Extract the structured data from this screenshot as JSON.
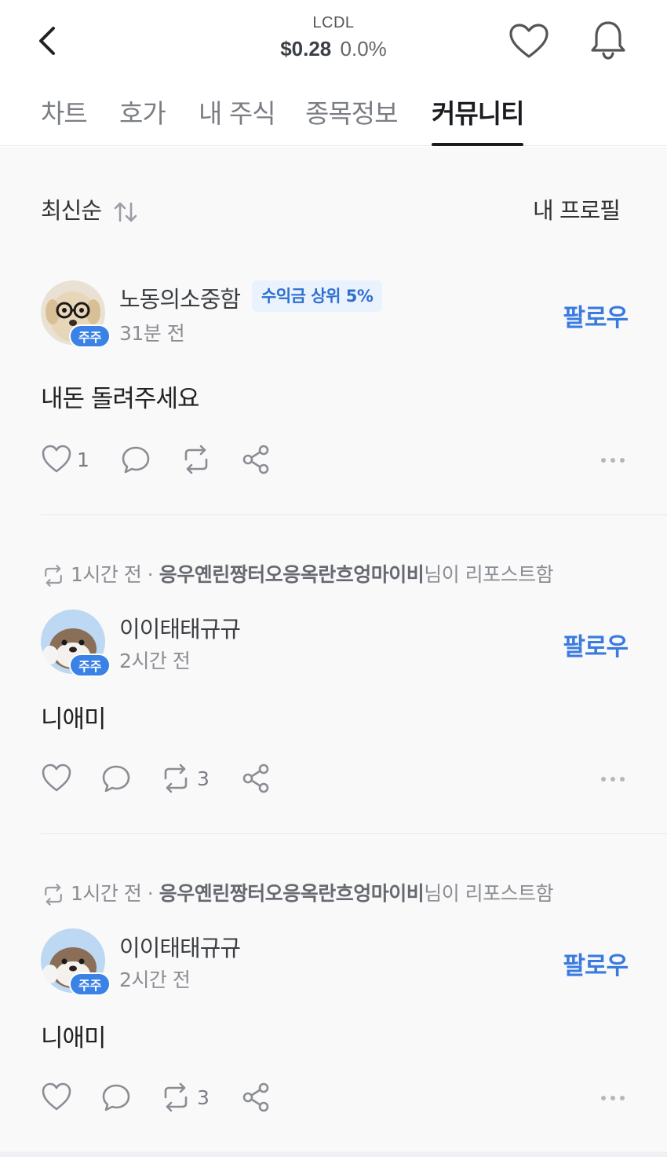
{
  "header": {
    "ticker": "LCDL",
    "price": "$0.28",
    "change": "0.0%"
  },
  "tabs": [
    {
      "label": "차트",
      "active": false
    },
    {
      "label": "호가",
      "active": false
    },
    {
      "label": "내 주식",
      "active": false
    },
    {
      "label": "종목정보",
      "active": false
    },
    {
      "label": "커뮤니티",
      "active": true
    }
  ],
  "sort": {
    "label": "최신순",
    "profile_link": "내 프로필"
  },
  "posts": [
    {
      "repost": null,
      "username": "노동의소중함",
      "rank_tag": "수익금 상위 5%",
      "holder_badge": "주주",
      "time": "31분 전",
      "follow_label": "팔로우",
      "content": "내돈 돌려주세요",
      "like_count": "1",
      "comment_count": "",
      "repost_count": ""
    },
    {
      "repost": {
        "time": "1시간 전",
        "sep": " · ",
        "name": "응우옌린짱터오응옥란흐엉마이비",
        "suffix": "님이 리포스트함"
      },
      "username": "이이태태규규",
      "rank_tag": "",
      "holder_badge": "주주",
      "time": "2시간 전",
      "follow_label": "팔로우",
      "content": "니애미",
      "like_count": "",
      "comment_count": "",
      "repost_count": "3"
    },
    {
      "repost": {
        "time": "1시간 전",
        "sep": " · ",
        "name": "응우옌린짱터오응옥란흐엉마이비",
        "suffix": "님이 리포스트함"
      },
      "username": "이이태태규규",
      "rank_tag": "",
      "holder_badge": "주주",
      "time": "2시간 전",
      "follow_label": "팔로우",
      "content": "니애미",
      "like_count": "",
      "comment_count": "",
      "repost_count": "3"
    }
  ],
  "colors": {
    "accent": "#3a7be0",
    "badge": "#3b82e6",
    "rank_tag_bg": "#eaf2fd"
  },
  "icons": {
    "back": "chevron-left-icon",
    "favorite": "heart-icon",
    "notifications": "bell-icon",
    "sort": "sort-arrows-icon",
    "like": "heart-icon",
    "comment": "comment-bubble-icon",
    "repost": "repost-icon",
    "share": "share-icon",
    "more": "more-dots-icon"
  }
}
